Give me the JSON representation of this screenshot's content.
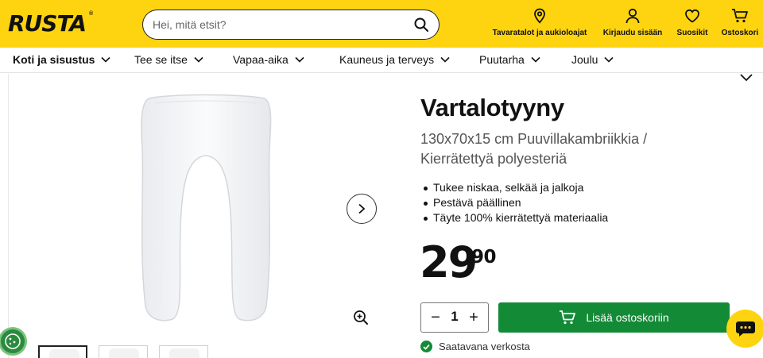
{
  "header": {
    "logo": "RUSTA",
    "search_placeholder": "Hei, mitä etsit?",
    "actions": [
      {
        "label": "Tavaratalot ja aukioloajat",
        "icon": "map-pin-icon"
      },
      {
        "label": "Kirjaudu sisään",
        "icon": "user-icon"
      },
      {
        "label": "Suosikit",
        "icon": "heart-icon"
      },
      {
        "label": "Ostoskori",
        "icon": "cart-icon"
      }
    ],
    "brand_color": "#fdd40f"
  },
  "nav": {
    "categories": [
      {
        "label": "Koti ja sisustus"
      },
      {
        "label": "Tee se itse"
      },
      {
        "label": "Vapaa-aika"
      },
      {
        "label": "Kauneus ja terveys"
      },
      {
        "label": "Puutarha"
      },
      {
        "label": "Joulu"
      }
    ]
  },
  "product": {
    "title": "Vartalotyyny",
    "subtitle": "130x70x15 cm Puuvillakambriikkia / Kierrätettyä polyesteriä",
    "bullets": [
      "Tukee niskaa, selkää ja jalkoja",
      "Pestävä päällinen",
      "Täyte 100% kierrätettyä materiaalia"
    ],
    "price_int": "29",
    "price_dec": "90",
    "quantity": "1",
    "add_to_cart": "Lisää ostoskoriin",
    "availability": "Saatavana verkosta",
    "accent_color": "#138a36"
  }
}
